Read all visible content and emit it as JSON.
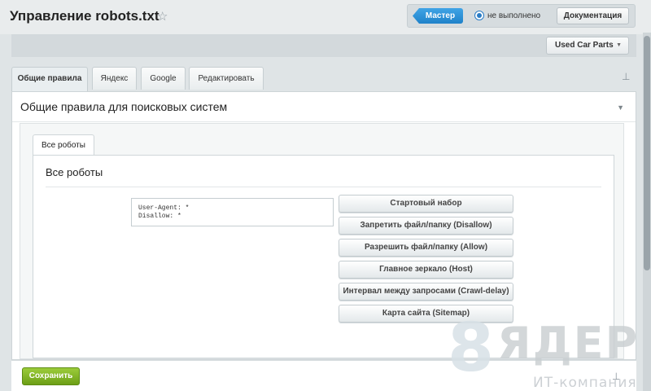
{
  "header": {
    "title": "Управление robots.txt",
    "favorite_icon": "star-icon",
    "master_label": "Мастер",
    "status_label": "не выполнено",
    "docs_label": "Документация"
  },
  "site_selector": {
    "value": "Used Car Parts"
  },
  "tabs": [
    {
      "label": "Общие правила",
      "active": true
    },
    {
      "label": "Яндекс",
      "active": false
    },
    {
      "label": "Google",
      "active": false
    },
    {
      "label": "Редактировать",
      "active": false
    }
  ],
  "panel": {
    "title": "Общие правила для поисковых систем",
    "subtab": "Все роботы",
    "box_title": "Все роботы",
    "robots_text": "User-Agent: *\nDisallow: *",
    "actions": [
      "Стартовый набор",
      "Запретить файл/папку (Disallow)",
      "Разрешить файл/папку (Allow)",
      "Главное зеркало (Host)",
      "Интервал между запросами (Crawl-delay)",
      "Карта сайта (Sitemap)"
    ]
  },
  "footer": {
    "save_label": "Сохранить"
  },
  "watermark": {
    "digit": "8",
    "word": "ЯДЕР",
    "subtitle": "ИТ-компания"
  },
  "colors": {
    "accent_blue": "#1f82c9",
    "save_green": "#7cae20"
  }
}
